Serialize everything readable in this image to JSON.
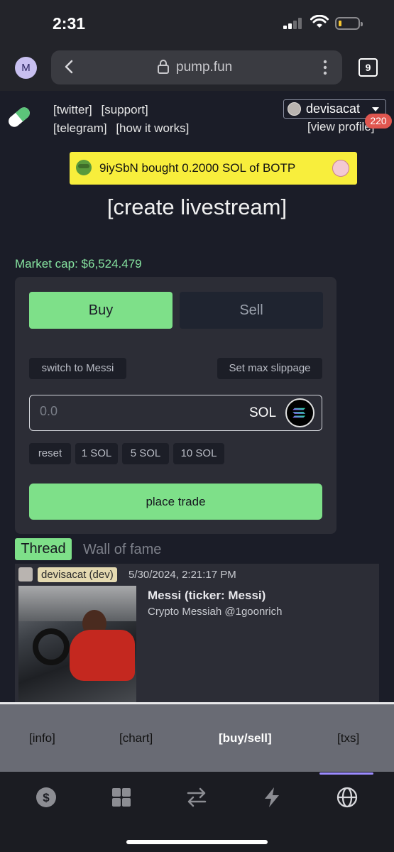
{
  "status_bar": {
    "time": "2:31",
    "icons": [
      "cellular-signal-icon",
      "wifi-icon",
      "battery-icon"
    ],
    "battery_color": "#f4c430"
  },
  "browser": {
    "profile_initial": "M",
    "url": "pump.fun",
    "tab_count": "9"
  },
  "header": {
    "links_row1": [
      "[twitter]",
      "[support]"
    ],
    "links_row2": [
      "[telegram]",
      "[how it works]"
    ],
    "username": "devisacat",
    "view_profile": "[view profile]",
    "notification_count": "220"
  },
  "ticker": {
    "text": "9iySbN  bought 0.2000 SOL of BOTP"
  },
  "create_livestream": "[create livestream]",
  "market_cap": "Market cap: $6,524.479",
  "trade": {
    "buy_label": "Buy",
    "sell_label": "Sell",
    "switch_label": "switch to Messi",
    "slippage_label": "Set max slippage",
    "amount_placeholder": "0.0",
    "currency": "SOL",
    "quick_amounts": [
      "reset",
      "1 SOL",
      "5 SOL",
      "10 SOL"
    ],
    "place_trade_label": "place trade",
    "accent_color": "#7ee089"
  },
  "thread": {
    "tab_thread": "Thread",
    "tab_wall": "Wall of fame",
    "post": {
      "author": "devisacat (dev)",
      "date": "5/30/2024, 2:21:17 PM",
      "title": "Messi (ticker: Messi)",
      "subtitle": "Crypto Messiah @1goonrich"
    }
  },
  "page_nav": [
    "[info]",
    "[chart]",
    "[buy/sell]",
    "[txs]"
  ],
  "tab_bar": {
    "icons": [
      "dollar-icon",
      "grid-icon",
      "swap-icon",
      "lightning-icon",
      "globe-icon"
    ],
    "active_index": 4
  }
}
